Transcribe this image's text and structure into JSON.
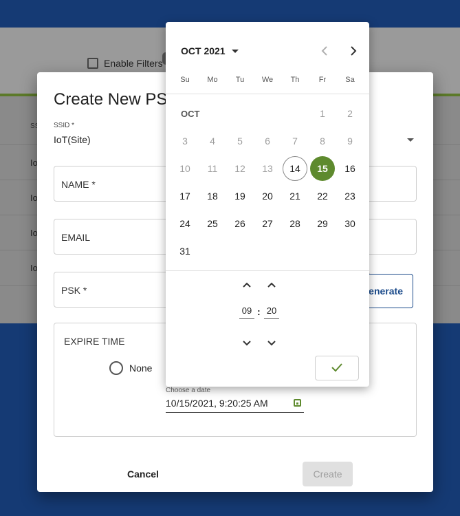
{
  "background": {
    "filter_label": "Enable Filters",
    "table_header": "SS",
    "rows": [
      "Io",
      "Io",
      "Io",
      "Io"
    ]
  },
  "dialog": {
    "title": "Create New PSK",
    "ssid_label": "SSID *",
    "ssid_value": "IoT(Site)",
    "name_label": "NAME *",
    "email_label": "EMAIL",
    "psk_label": "PSK *",
    "generate_psk_label": "Generate PSK",
    "expire_title": "EXPIRE TIME",
    "none_label": "None",
    "date_label": "Choose a date",
    "date_value": "10/15/2021, 9:20:25 AM",
    "cancel_label": "Cancel",
    "create_label": "Create"
  },
  "picker": {
    "month_year": "OCT 2021",
    "weekdays": [
      "Su",
      "Mo",
      "Tu",
      "We",
      "Th",
      "Fr",
      "Sa"
    ],
    "month_short": "OCT",
    "weeks": [
      [
        "",
        "",
        "",
        "",
        "",
        "1",
        "2"
      ],
      [
        "3",
        "4",
        "5",
        "6",
        "7",
        "8",
        "9"
      ],
      [
        "10",
        "11",
        "12",
        "13",
        "14",
        "15",
        "16"
      ],
      [
        "17",
        "18",
        "19",
        "20",
        "21",
        "22",
        "23"
      ],
      [
        "24",
        "25",
        "26",
        "27",
        "28",
        "29",
        "30"
      ],
      [
        "31",
        "",
        "",
        "",
        "",
        "",
        ""
      ]
    ],
    "today": "14",
    "selected": "15",
    "hour": "09",
    "minute": "20",
    "time_separator": ":",
    "accent_color": "#5e8a2e"
  }
}
